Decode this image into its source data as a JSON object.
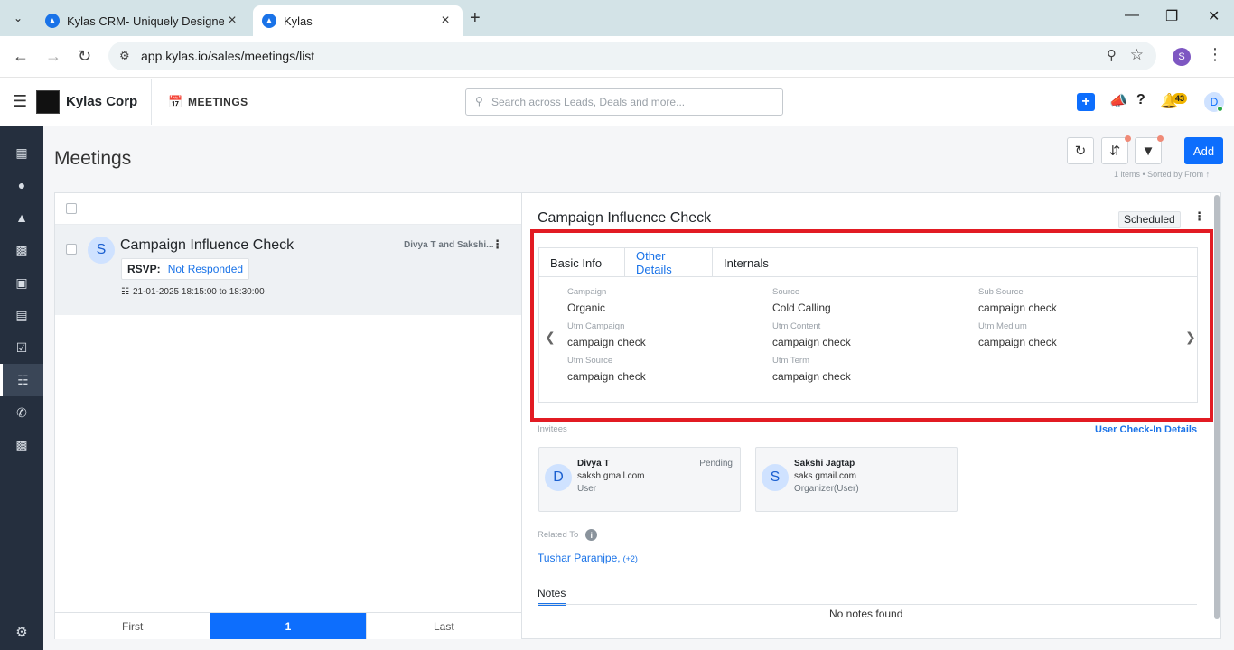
{
  "browser": {
    "tabs": [
      {
        "title": "Kylas CRM- Uniquely Designed",
        "active": false
      },
      {
        "title": "Kylas",
        "active": true
      }
    ],
    "url": "app.kylas.io/sales/meetings/list",
    "profile_initial": "S"
  },
  "header": {
    "company": "Kylas Corp",
    "module": "MEETINGS",
    "search_placeholder": "Search across Leads, Deals and more...",
    "notification_count": "43",
    "user_initial": "D"
  },
  "page": {
    "title": "Meetings",
    "add_label": "Add",
    "sort_info": "1 items • Sorted by  From ↑"
  },
  "list": {
    "item": {
      "initial": "S",
      "title": "Campaign Influence Check",
      "owners": "Divya T and Sakshi...",
      "rsvp_label": "RSVP:",
      "rsvp_value": "Not Responded",
      "date": "21-01-2025 18:15:00 to 18:30:00"
    },
    "pager": {
      "first": "First",
      "current": "1",
      "last": "Last"
    }
  },
  "detail": {
    "title": "Campaign Influence Check",
    "status": "Scheduled",
    "tabs": [
      "Basic Info",
      "Other Details",
      "Internals"
    ],
    "active_tab": "Other Details",
    "fields": [
      {
        "label": "Campaign",
        "value": "Organic"
      },
      {
        "label": "Source",
        "value": "Cold Calling"
      },
      {
        "label": "Sub Source",
        "value": "campaign check"
      },
      {
        "label": "Utm Campaign",
        "value": "campaign check"
      },
      {
        "label": "Utm Content",
        "value": "campaign check"
      },
      {
        "label": "Utm Medium",
        "value": "campaign check"
      },
      {
        "label": "Utm Source",
        "value": "campaign check"
      },
      {
        "label": "Utm Term",
        "value": "campaign check"
      }
    ],
    "invitees_label": "Invitees",
    "checkin_link": "User Check-In Details",
    "invitees": [
      {
        "initial": "D",
        "name": "Divya T",
        "email": "saksh          gmail.com",
        "role": "User",
        "status": "Pending"
      },
      {
        "initial": "S",
        "name": "Sakshi Jagtap",
        "email": "saks                    gmail.com",
        "role": "Organizer(User)",
        "status": ""
      }
    ],
    "related_label": "Related To",
    "related_name": "Tushar Paranjpe,",
    "related_more": "(+2)",
    "notes_tab": "Notes",
    "no_notes": "No notes found"
  }
}
